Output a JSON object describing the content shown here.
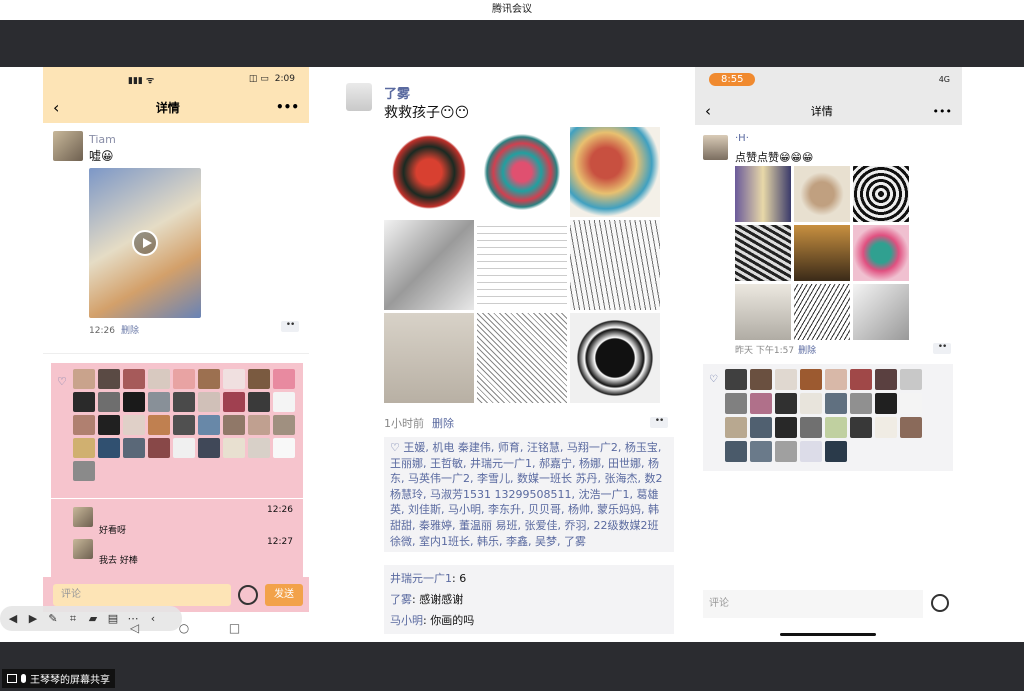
{
  "window": {
    "title": "腾讯会议"
  },
  "share": {
    "label": "王琴琴的屏幕共享"
  },
  "panel1": {
    "status_time": "2:09",
    "nav_title": "详情",
    "post": {
      "author": "Tiam",
      "text": "嘘😀",
      "time": "12:26",
      "delete": "删除",
      "more": "••"
    },
    "comments": [
      {
        "author": "",
        "text": "好看呀",
        "time": "12:26"
      },
      {
        "author": "",
        "text": "我去 好棒",
        "time": "12:27"
      }
    ],
    "input_placeholder": "评论",
    "send_label": "发送"
  },
  "panel2": {
    "author": "了雾",
    "text": "救救孩子😶😶",
    "time": "1小时前",
    "delete": "删除",
    "more": "••",
    "likes_text": "♡ 王媛, 机电 秦建伟, 师育, 汪铭慧, 马翔一广2, 杨玉宝, 王丽娜, 王哲敏, 井瑞元一广1, 郝嘉宁, 杨娜, 田世娜, 杨东, 马英伟一广2, 李雪儿, 数媒一班长 苏丹, 张海杰, 数2 杨慧玲, 马淑芳1531 13299508511, 沈浩一广1, 葛雄英, 刘佳斯, 马小明, 李东升, 贝贝哥, 杨帅, 蒙乐妈妈, 韩甜甜, 秦雅婷, 董温丽 易班, 张爱佳, 乔羽, 22级数媒2班 徐微, 室内1班长, 韩乐, 李鑫, 吴梦, 了雾",
    "comments": [
      {
        "author": "井瑞元一广1",
        "text": "6"
      },
      {
        "author": "了雾",
        "text": "感谢感谢"
      },
      {
        "author": "马小明",
        "text": "你画的吗"
      }
    ]
  },
  "panel3": {
    "status_time": "8:55",
    "status_right": "4G",
    "nav_title": "详情",
    "author": "·H·",
    "text": "点赞点赞😁😁😁",
    "time": "昨天 下午1:57",
    "delete": "删除",
    "more": "••",
    "input_placeholder": "评论"
  },
  "colors": {
    "accent_link": "#5a6aa0",
    "panel1_bg": "#fde4b6",
    "panel1_highlight": "#f6c4cd",
    "send_button": "#f2a24a",
    "status_pill": "#f08a2f",
    "meeting_bar": "#2b2c30"
  },
  "icons": {
    "back": "chevron-left-icon",
    "more": "more-dots-icon",
    "heart": "heart-icon",
    "emoji": "emoji-icon",
    "play": "play-icon"
  }
}
